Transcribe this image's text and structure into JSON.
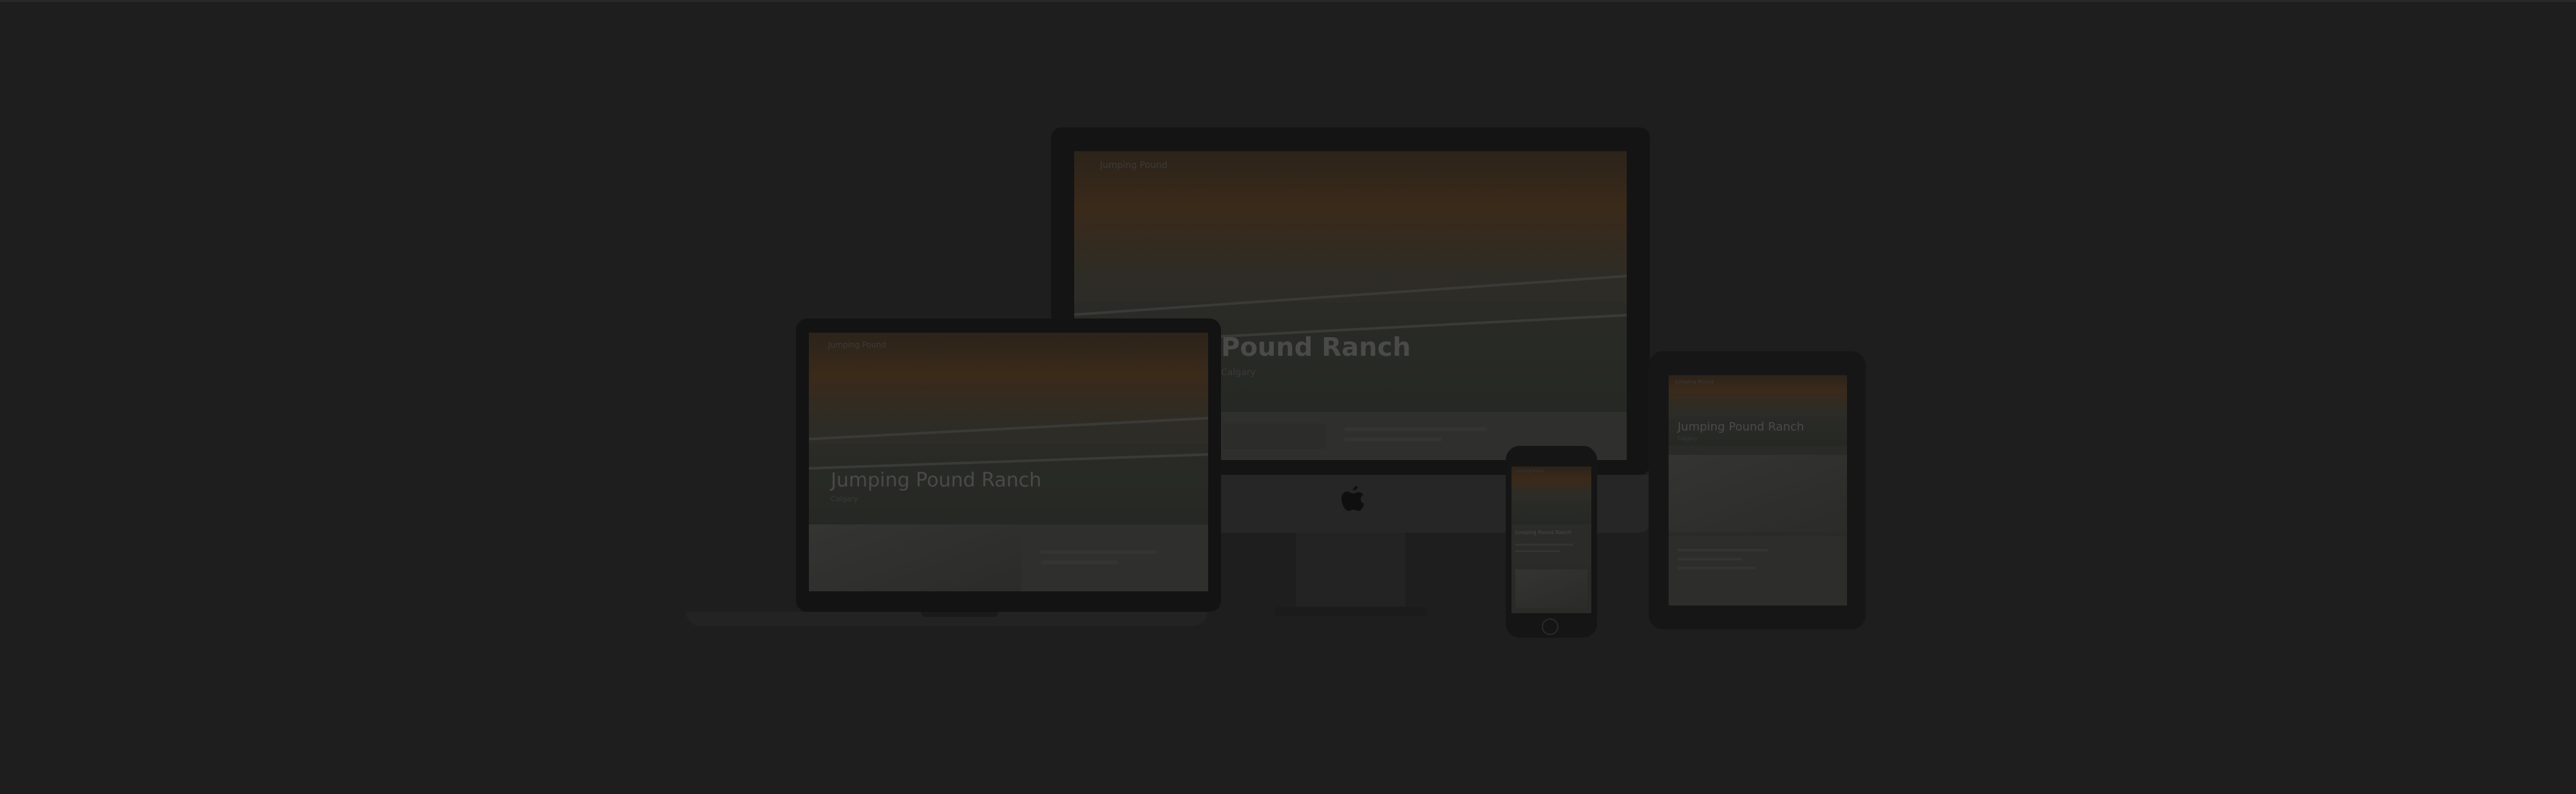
{
  "imac": {
    "logo": "Jumping Pound",
    "title": "Pound Ranch",
    "subtitle": "Calgary"
  },
  "macbook": {
    "logo": "Jumping Pound",
    "title": "Jumping Pound Ranch",
    "subtitle": "Calgary"
  },
  "ipad": {
    "logo": "Jumping Pound",
    "title": "Jumping Pound Ranch",
    "subtitle": "Calgary"
  },
  "phone": {
    "logo": "Jumping Pound",
    "title": "Jumping Pound Ranch"
  },
  "icons": {
    "apple": "apple-logo-icon"
  },
  "colors": {
    "background": "#1e1e1e",
    "device_frame": "#141414",
    "hero_warm": "#3a2a1a"
  }
}
